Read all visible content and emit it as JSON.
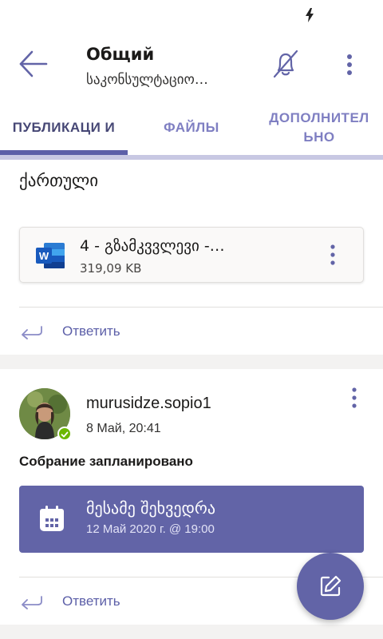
{
  "header": {
    "title": "Общий",
    "subtitle": "საკონსულტაციო…"
  },
  "tabs": [
    {
      "label": "ПУБЛИКАЦИ И",
      "active": true
    },
    {
      "label": "ФАЙЛЫ",
      "active": false
    },
    {
      "label": "ДОПОЛНИТЕЛ ЬНО",
      "active": false
    }
  ],
  "post1": {
    "text": "ქართული",
    "attachment": {
      "icon": "word-icon",
      "name": "4 - გზამკვვლევი -…",
      "size": "319,09 KB"
    },
    "reply_label": "Ответить"
  },
  "post2": {
    "author": "murusidze.sopio1",
    "time": "8 Май, 20:41",
    "message": "Собрание запланировано",
    "meeting": {
      "icon": "calendar-icon",
      "name": "მესამე შეხვედრა",
      "datetime": "12 Май 2020 г. @ 19:00"
    },
    "reply_label": "Ответить"
  },
  "colors": {
    "accent": "#6264a7",
    "tab_active": "#464775",
    "tab_inactive": "#7f7fc2",
    "presence": "#6bb700"
  }
}
